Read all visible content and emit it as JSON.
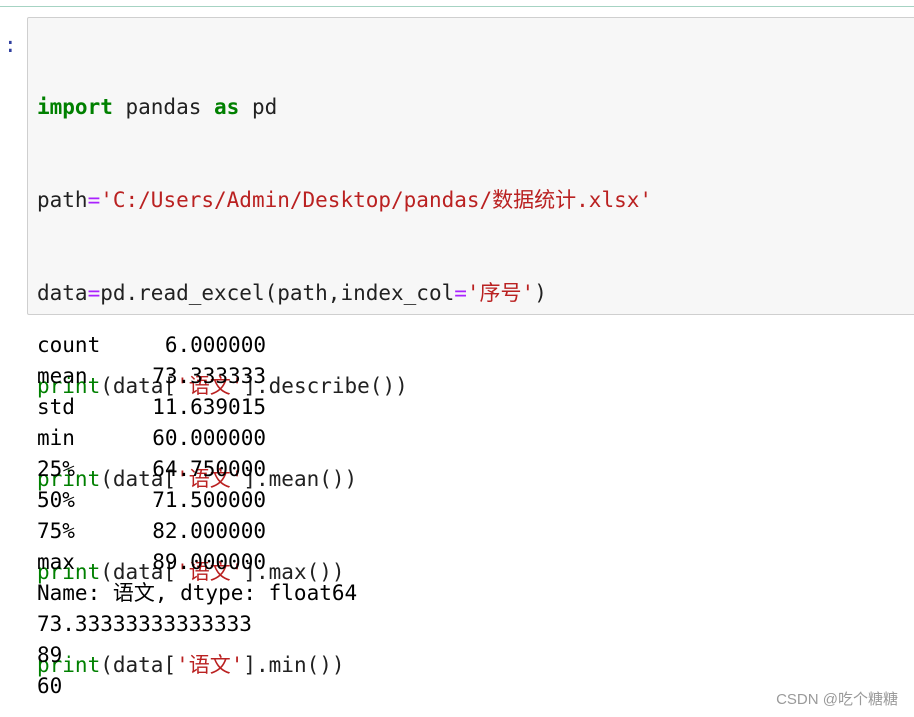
{
  "prompt": ":",
  "code": {
    "line1": {
      "kw1": "import",
      "t1": " pandas ",
      "kw2": "as",
      "t2": " pd"
    },
    "line2": {
      "lhs": "path",
      "eq": "=",
      "str": "'C:/Users/Admin/Desktop/pandas/数据统计.xlsx'"
    },
    "line3": {
      "lhs": "data",
      "eq": "=",
      "call": "pd.read_excel(path,index_col",
      "eq2": "=",
      "str": "'序号'",
      "close": ")"
    },
    "line4": {
      "fn": "print",
      "pre": "(data[",
      "str": "'语文'",
      "post": "].describe())"
    },
    "line5": {
      "fn": "print",
      "pre": "(data[",
      "str": "'语文'",
      "post": "].mean())"
    },
    "line6": {
      "fn": "print",
      "pre": "(data[",
      "str": "'语文'",
      "post": "].max())"
    },
    "line7": {
      "fn": "print",
      "pre": "(data[",
      "str": "'语文'",
      "post": "].min())"
    }
  },
  "output": {
    "describe_rows": [
      {
        "key": "count",
        "value": "6.000000"
      },
      {
        "key": "mean",
        "value": "73.333333"
      },
      {
        "key": "std",
        "value": "11.639015"
      },
      {
        "key": "min",
        "value": "60.000000"
      },
      {
        "key": "25%",
        "value": "64.750000"
      },
      {
        "key": "50%",
        "value": "71.500000"
      },
      {
        "key": "75%",
        "value": "82.000000"
      },
      {
        "key": "max",
        "value": "89.000000"
      }
    ],
    "name_line": "Name: 语文, dtype: float64",
    "mean_value": "73.33333333333333",
    "max_value": "89",
    "min_value": "60"
  },
  "watermark": "CSDN @吃个糖糖",
  "colors": {
    "keyword": "#008000",
    "string": "#ba2121",
    "cell_background": "#f7f7f7",
    "cell_border": "#cfcfcf"
  }
}
